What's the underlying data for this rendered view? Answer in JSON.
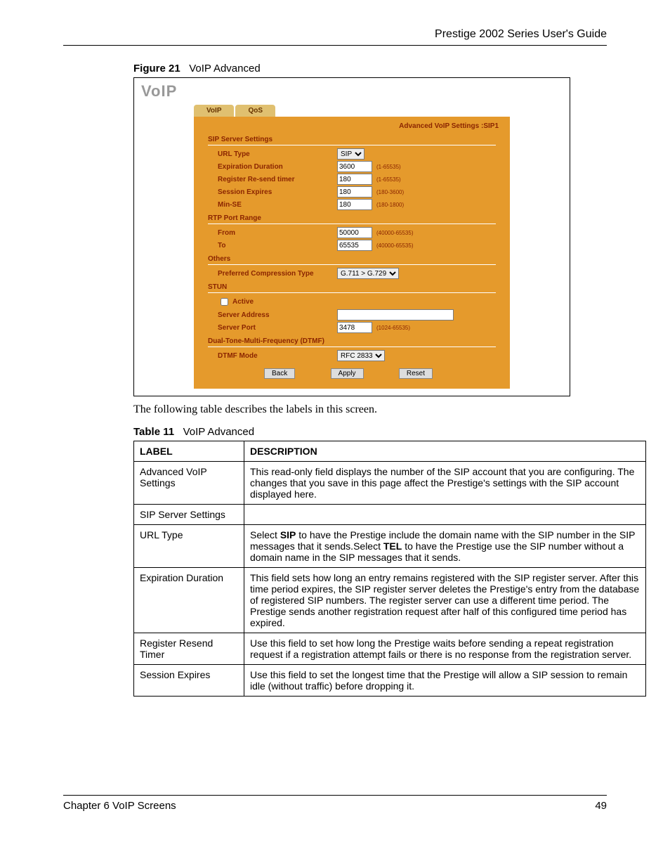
{
  "header": {
    "title": "Prestige 2002 Series User's Guide"
  },
  "figure": {
    "label": "Figure 21",
    "title": "VoIP Advanced"
  },
  "shot": {
    "heading": "VoIP",
    "tabs": {
      "voip": "VoIP",
      "qos": "QoS"
    },
    "right_title": "Advanced VoIP Settings :SIP1",
    "sections": {
      "sip": "SIP Server Settings",
      "rtp": "RTP Port Range",
      "others": "Others",
      "stun": "STUN",
      "dtmf": "Dual-Tone-Multi-Frequency (DTMF)"
    },
    "fields": {
      "url_type": "URL Type",
      "url_type_value": "SIP",
      "exp_dur": "Expiration Duration",
      "exp_dur_value": "3600",
      "exp_dur_hint": "(1-65535)",
      "resend": "Register Re-send timer",
      "resend_value": "180",
      "resend_hint": "(1-65535)",
      "sess_exp": "Session Expires",
      "sess_exp_value": "180",
      "sess_exp_hint": "(180-3600)",
      "min_se": "Min-SE",
      "min_se_value": "180",
      "min_se_hint": "(180-1800)",
      "from": "From",
      "from_value": "50000",
      "from_hint": "(40000-65535)",
      "to": "To",
      "to_value": "65535",
      "to_hint": "(40000-65535)",
      "compression": "Preferred Compression Type",
      "compression_value": "G.711 > G.729",
      "active": "Active",
      "server_addr": "Server Address",
      "server_addr_value": "",
      "server_port": "Server Port",
      "server_port_value": "3478",
      "server_port_hint": "(1024-65535)",
      "dtmf_mode": "DTMF Mode",
      "dtmf_mode_value": "RFC 2833"
    },
    "buttons": {
      "back": "Back",
      "apply": "Apply",
      "reset": "Reset"
    }
  },
  "intro": "The following table describes the labels in this screen.",
  "table": {
    "label": "Table 11",
    "title": "VoIP Advanced",
    "head_label": "LABEL",
    "head_desc": "DESCRIPTION",
    "rows": [
      {
        "label": "Advanced VoIP Settings",
        "desc": "This read-only field displays the number of the SIP account that you are configuring. The changes that you save in this page affect the Prestige's settings with the SIP account displayed here."
      },
      {
        "label": "SIP Server Settings",
        "desc": ""
      },
      {
        "label": "URL Type",
        "desc_html": "Select <b>SIP</b> to have the Prestige include the domain name with the SIP number in the SIP messages that it sends.Select <b>TEL</b> to have the Prestige use the SIP number without a domain name in the SIP messages that it sends."
      },
      {
        "label": "Expiration Duration",
        "desc": "This field sets how long an entry remains registered with the SIP register server. After this time period expires, the SIP register server deletes the Prestige's entry from the database of registered SIP numbers. The register server can use a different time period. The Prestige sends another registration request after half of this configured time period has expired."
      },
      {
        "label": "Register Resend Timer",
        "desc": "Use this field to set how long the Prestige waits before sending a repeat registration request if a registration attempt fails or there is no response from the registration server."
      },
      {
        "label": "Session Expires",
        "desc": "Use this field to set the longest time that the Prestige will allow a SIP session to remain idle (without traffic) before dropping it."
      }
    ]
  },
  "footer": {
    "chapter": "Chapter 6 VoIP Screens",
    "page": "49"
  }
}
